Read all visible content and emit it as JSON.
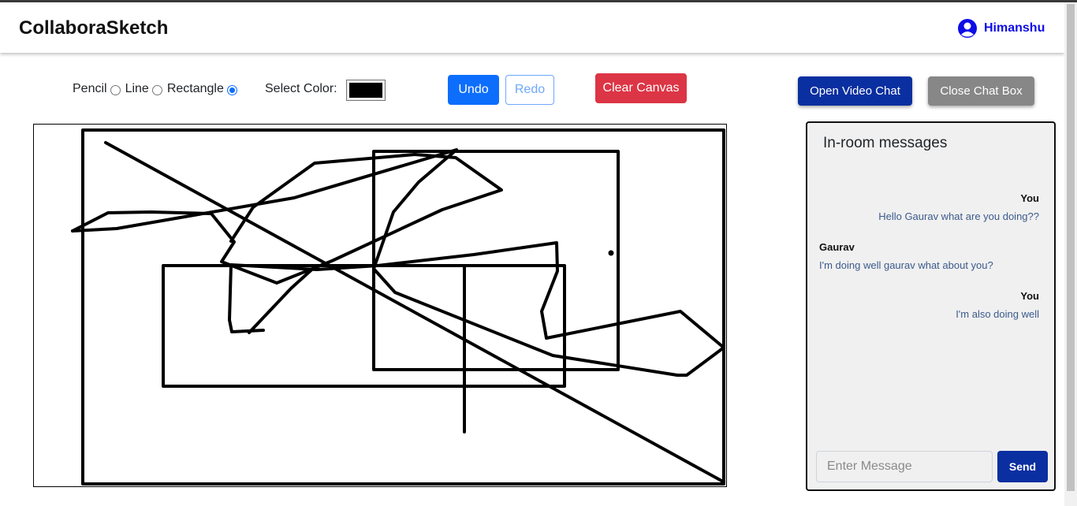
{
  "app": {
    "brand": "CollaboraSketch",
    "user_name": "Himanshu"
  },
  "tools": {
    "items": [
      {
        "label": "Pencil",
        "checked": false
      },
      {
        "label": "Line",
        "checked": false
      },
      {
        "label": "Rectangle",
        "checked": true
      }
    ],
    "color_label": "Select Color:",
    "selected_color": "#000000"
  },
  "buttons": {
    "undo": "Undo",
    "redo": "Redo",
    "clear": "Clear Canvas",
    "video": "Open Video Chat",
    "close_chat": "Close Chat Box",
    "send": "Send"
  },
  "chat": {
    "title": "In-room messages",
    "messages": [
      {
        "author": "You",
        "text": "Hello Gaurav what are you doing??",
        "side": "right"
      },
      {
        "author": "Gaurav",
        "text": "I'm doing well gaurav what about you?",
        "side": "left"
      },
      {
        "author": "You",
        "text": "I'm also doing well",
        "side": "right"
      }
    ],
    "input_placeholder": "Enter Message"
  },
  "colors": {
    "primary": "#0d6efd",
    "danger": "#dc3545",
    "navy": "#0a2fa0",
    "secondary": "#878787",
    "user_link": "#0d0de6"
  },
  "icons": {
    "user": "user-circle-icon"
  }
}
